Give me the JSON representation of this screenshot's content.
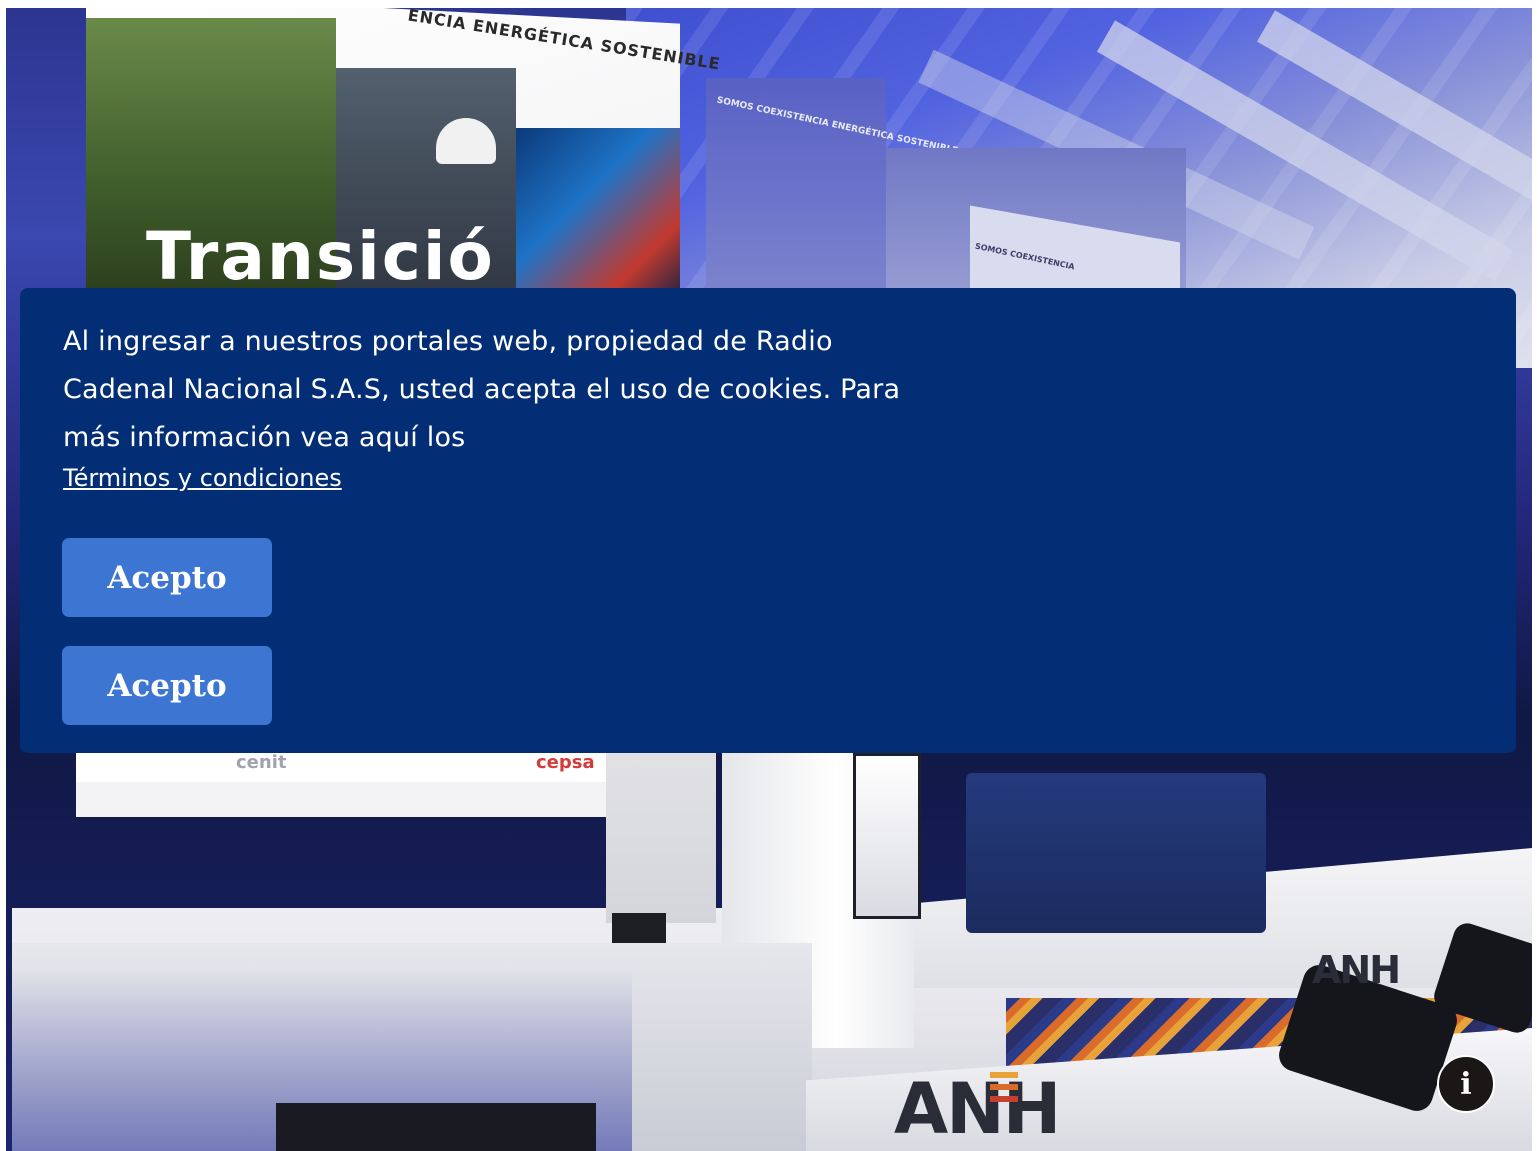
{
  "cookie_notice": {
    "message": "Al ingresar a nuestros portales web, propiedad de Radio Cadenal Nacional S.A.S, usted acepta el uso de cookies. Para más información vea aquí los",
    "link_label": "Términos y condiciones",
    "accept_label": "Acepto",
    "duplicate_accept_label": "Acepto",
    "background_color": "#032e75",
    "button_color": "#3c75d2"
  },
  "background_photo": {
    "banner_heading": "ENCIA ENERGÉTICA SOSTENIBLE",
    "banner_big_word": "Transició",
    "wall_text_1": "SOMOS COEXISTENCIA ENERGÉTICA SOSTENIBLE",
    "wall_text_2": "SOMOS COEXISTENCIA",
    "stage_logo": "ANH",
    "sponsor_logos": [
      "cenit",
      "cepsa"
    ]
  },
  "info_button": {
    "icon": "info-icon",
    "glyph": "i"
  }
}
